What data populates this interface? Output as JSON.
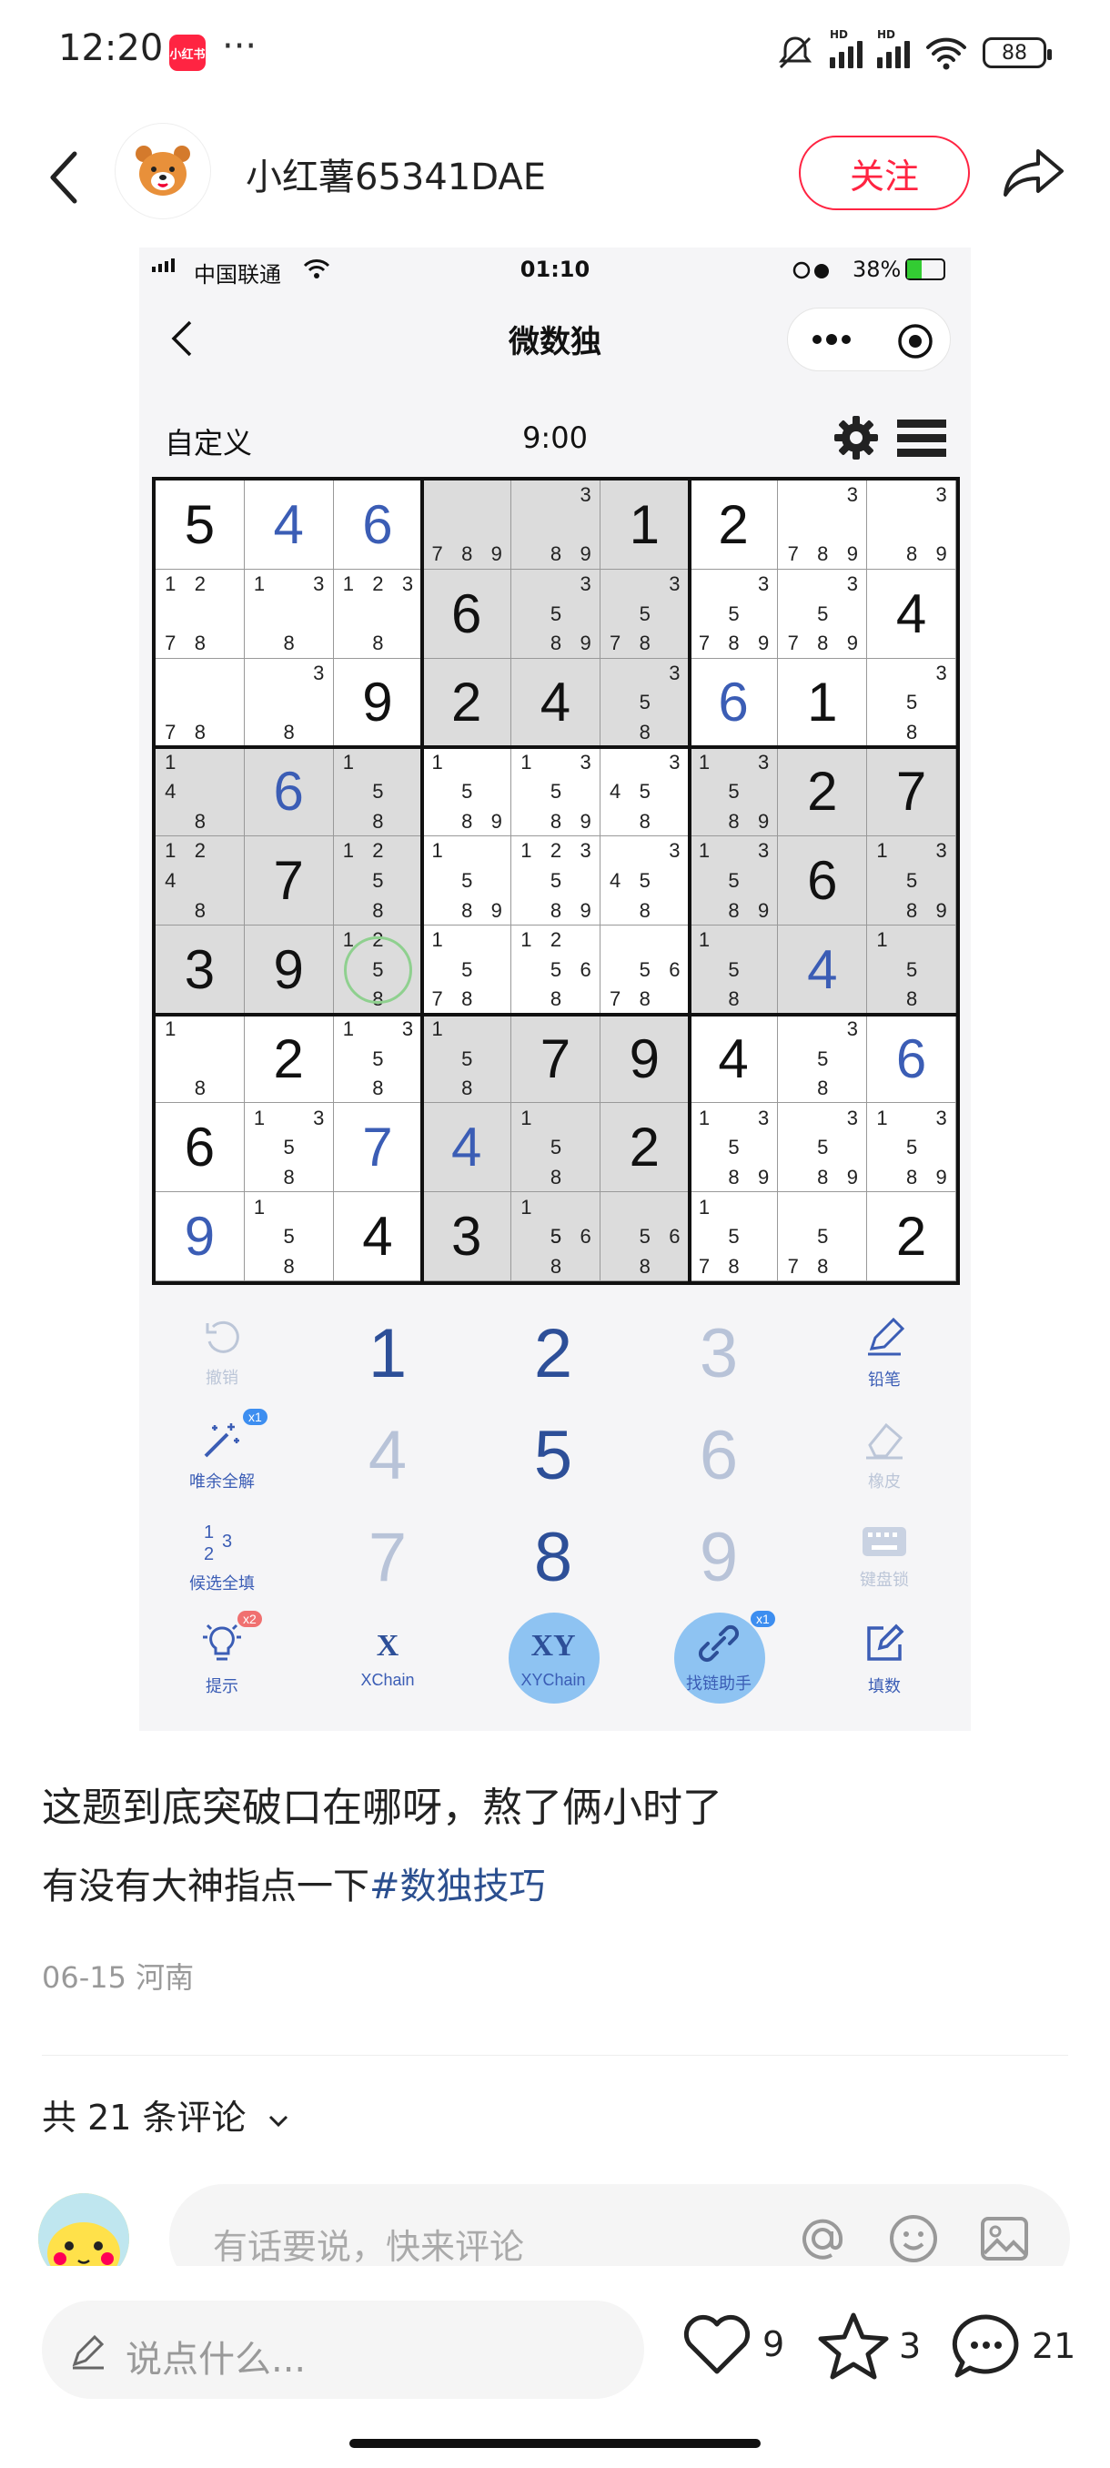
{
  "status": {
    "time": "12:20",
    "app_badge": "小红书",
    "dots": "···",
    "net1": "HD",
    "net2": "HD",
    "battery": "88"
  },
  "header": {
    "username": "小红薯65341DAE",
    "follow": "关注"
  },
  "shot": {
    "carrier": "中国联通",
    "time": "01:10",
    "battery": "38%",
    "title": "微数独",
    "mode": "自定义",
    "timer": "9:00",
    "grid": [
      [
        {
          "v": "5"
        },
        {
          "v": "4",
          "b": 1
        },
        {
          "v": "6",
          "b": 1
        },
        {
          "c": "789"
        },
        {
          "c": "389"
        },
        {
          "v": "1"
        },
        {
          "v": "2"
        },
        {
          "c": "3789"
        },
        {
          "c": "389"
        }
      ],
      [
        {
          "c": "1278"
        },
        {
          "c": "138"
        },
        {
          "c": "1238"
        },
        {
          "v": "6"
        },
        {
          "c": "3589"
        },
        {
          "c": "3578"
        },
        {
          "c": "35789"
        },
        {
          "c": "35789"
        },
        {
          "v": "4"
        }
      ],
      [
        {
          "c": "78"
        },
        {
          "c": "38"
        },
        {
          "v": "9"
        },
        {
          "v": "2"
        },
        {
          "v": "4"
        },
        {
          "c": "358"
        },
        {
          "v": "6",
          "b": 1
        },
        {
          "v": "1"
        },
        {
          "c": "358"
        }
      ],
      [
        {
          "c": "148"
        },
        {
          "v": "6",
          "b": 1
        },
        {
          "c": "158"
        },
        {
          "c": "1589"
        },
        {
          "c": "13589"
        },
        {
          "c": "3458"
        },
        {
          "c": "13589"
        },
        {
          "v": "2"
        },
        {
          "v": "7"
        }
      ],
      [
        {
          "c": "1248"
        },
        {
          "v": "7"
        },
        {
          "c": "1258"
        },
        {
          "c": "1589"
        },
        {
          "c": "123589"
        },
        {
          "c": "3458"
        },
        {
          "c": "13589"
        },
        {
          "v": "6"
        },
        {
          "c": "13589"
        }
      ],
      [
        {
          "v": "3"
        },
        {
          "v": "9"
        },
        {
          "c": "1258"
        },
        {
          "c": "1578"
        },
        {
          "c": "12568"
        },
        {
          "c": "5678"
        },
        {
          "c": "158"
        },
        {
          "v": "4",
          "b": 1
        },
        {
          "c": "158"
        }
      ],
      [
        {
          "c": "18"
        },
        {
          "v": "2"
        },
        {
          "c": "1358"
        },
        {
          "c": "158"
        },
        {
          "v": "7"
        },
        {
          "v": "9"
        },
        {
          "v": "4"
        },
        {
          "c": "358"
        },
        {
          "v": "6",
          "b": 1
        }
      ],
      [
        {
          "v": "6"
        },
        {
          "c": "1358"
        },
        {
          "v": "7",
          "b": 1
        },
        {
          "v": "4",
          "b": 1
        },
        {
          "c": "158"
        },
        {
          "v": "2"
        },
        {
          "c": "13589"
        },
        {
          "c": "3589"
        },
        {
          "c": "13589"
        }
      ],
      [
        {
          "v": "9",
          "b": 1
        },
        {
          "c": "158"
        },
        {
          "v": "4"
        },
        {
          "v": "3"
        },
        {
          "c": "15568"
        },
        {
          "c": "568"
        },
        {
          "c": "1578"
        },
        {
          "c": "578"
        },
        {
          "v": "2"
        }
      ]
    ],
    "pad": {
      "undo": "撤销",
      "pencil": "铅笔",
      "solve_all": "唯余全解",
      "eraser": "橡皮",
      "fill_candidates": "候选全填",
      "keyboard_lock": "键盘锁",
      "hint": "提示",
      "xchain": "XChain",
      "xychain": "XYChain",
      "chain_helper": "找链助手",
      "fill_number": "填数",
      "x_glyph": "X",
      "xy_glyph": "XY",
      "badge_x1": "x1",
      "badge_x2": "x2",
      "n1": "1",
      "n2": "2",
      "n3": "3",
      "n4": "4",
      "n5": "5",
      "n6": "6",
      "n7": "7",
      "n8": "8",
      "n9": "9"
    }
  },
  "post": {
    "title": "这题到底突破口在哪呀，熬了俩小时了",
    "body": "有没有大神指点一下",
    "tag": "#数独技巧",
    "meta": "06-15 河南",
    "comments_label": "共 21 条评论",
    "comment_placeholder": "有话要说，快来评论",
    "say_placeholder": "说点什么...",
    "likes": "9",
    "stars": "3",
    "comments": "21"
  },
  "colors": {
    "accent": "#ff2442",
    "given_blue": "#3b5db5",
    "tag_blue": "#2b4f8f"
  }
}
